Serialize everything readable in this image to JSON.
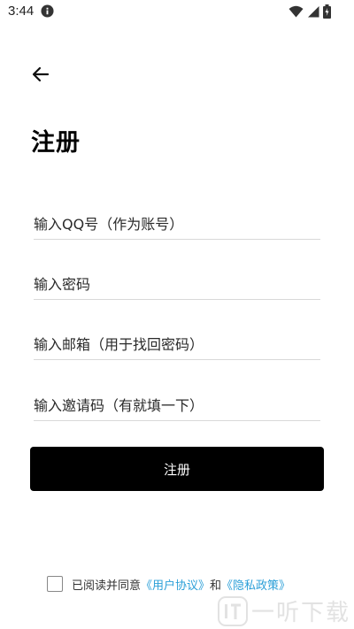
{
  "status_bar": {
    "time": "3:44"
  },
  "page": {
    "title": "注册"
  },
  "form": {
    "qq_placeholder": "输入QQ号（作为账号）",
    "password_placeholder": "输入密码",
    "email_placeholder": "输入邮箱（用于找回密码）",
    "invite_placeholder": "输入邀请码（有就填一下）",
    "submit_label": "注册"
  },
  "agreement": {
    "prefix": "已阅读并同意",
    "user_agreement": "《用户协议》",
    "conjunction": "和",
    "privacy_policy": "《隐私政策》",
    "link_color": "#2b9fd8"
  },
  "watermark": {
    "text": "一听下载"
  }
}
